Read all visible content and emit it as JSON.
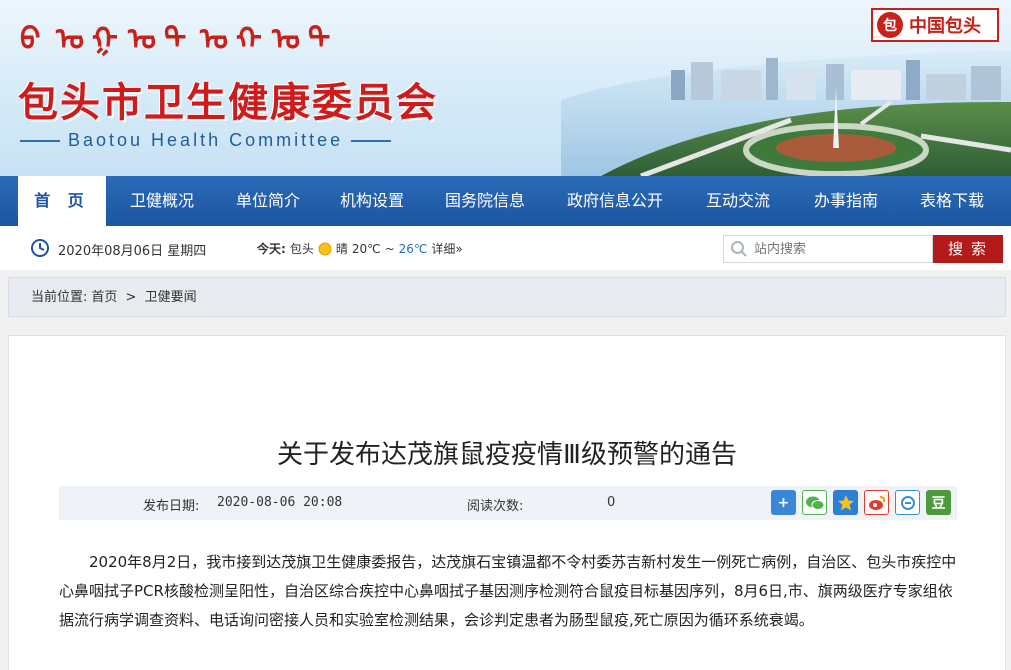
{
  "header": {
    "mongolian_glyphs": [
      "ᠪ",
      "ᠣ",
      "ᠭ",
      "ᠣ",
      "ᠲ",
      "ᠤ",
      "ᠬ",
      "ᠣ",
      "ᠲ"
    ],
    "title": "包头市卫生健康委员会",
    "subtitle": "Baotou Health Committee",
    "brand": "中国包头"
  },
  "nav": {
    "items": [
      {
        "label": "首 页",
        "active": true
      },
      {
        "label": "卫健概况",
        "active": false
      },
      {
        "label": "单位简介",
        "active": false
      },
      {
        "label": "机构设置",
        "active": false
      },
      {
        "label": "国务院信息",
        "active": false
      },
      {
        "label": "政府信息公开",
        "active": false
      },
      {
        "label": "互动交流",
        "active": false
      },
      {
        "label": "办事指南",
        "active": false
      },
      {
        "label": "表格下载",
        "active": false
      }
    ]
  },
  "infobar": {
    "date": "2020年08月06日 星期四",
    "weather_prefix": "今天:",
    "city": "包头",
    "condition": "晴",
    "temp_low": "20℃",
    "sep": "~",
    "temp_high": "26℃",
    "details": "详细»",
    "search_placeholder": "站内搜索",
    "search_button": "搜索"
  },
  "breadcrumb": {
    "prefix": "当前位置:",
    "items": [
      "首页",
      ">",
      "卫健要闻"
    ]
  },
  "article": {
    "title": "关于发布达茂旗鼠疫疫情Ⅲ级预警的通告",
    "date_label": "发布日期:",
    "date_value": "2020-08-06 20:08",
    "reads_label": "阅读次数:",
    "reads_value": "0",
    "share_icons": [
      "plus-icon",
      "wechat-icon",
      "star-icon",
      "weibo-icon",
      "tencent-icon",
      "douban-icon"
    ],
    "body": "2020年8月2日，我市接到达茂旗卫生健康委报告，达茂旗石宝镇温都不令村委苏吉新村发生一例死亡病例，自治区、包头市疾控中心鼻咽拭子PCR核酸检测呈阳性，自治区综合疾控中心鼻咽拭子基因测序检测符合鼠疫目标基因序列，8月6日,市、旗两级医疗专家组依据流行病学调查资料、电话询问密接人员和实验室检测结果，会诊判定患者为肠型鼠疫,死亡原因为循环系统衰竭。"
  },
  "colors": {
    "nav_bg": "#1d55a0",
    "brand_red": "#c8201a",
    "search_red": "#b51a1a"
  }
}
